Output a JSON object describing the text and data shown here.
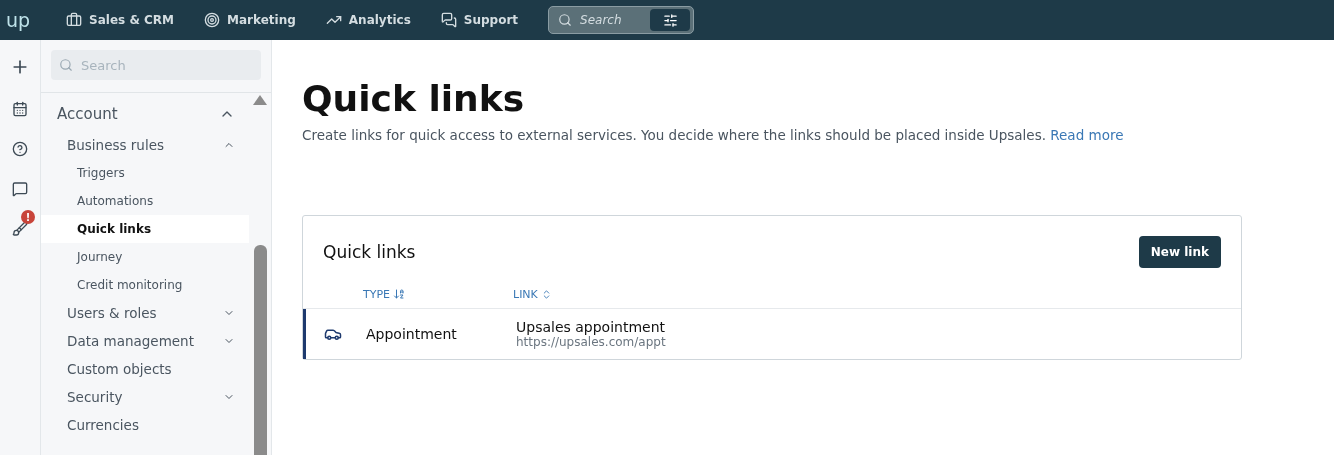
{
  "topbar": {
    "logo": "up",
    "nav": [
      {
        "label": "Sales & CRM"
      },
      {
        "label": "Marketing"
      },
      {
        "label": "Analytics"
      },
      {
        "label": "Support"
      }
    ],
    "search": {
      "placeholder": "Search"
    }
  },
  "rail": {
    "alert_badge": "!"
  },
  "sidebar": {
    "search": {
      "placeholder": "Search"
    },
    "items": [
      {
        "label": "Account",
        "kind": "group",
        "expanded": true,
        "selected": false,
        "children": [
          {
            "label": "Business rules",
            "kind": "group",
            "expanded": true,
            "selected": false,
            "children": [
              {
                "label": "Triggers",
                "kind": "page",
                "selected": false
              },
              {
                "label": "Automations",
                "kind": "page",
                "selected": false
              },
              {
                "label": "Quick links",
                "kind": "page",
                "selected": true
              },
              {
                "label": "Journey",
                "kind": "page",
                "selected": false
              },
              {
                "label": "Credit monitoring",
                "kind": "page",
                "selected": false
              }
            ]
          },
          {
            "label": "Users & roles",
            "kind": "group",
            "expanded": false,
            "selected": false
          },
          {
            "label": "Data management",
            "kind": "group",
            "expanded": false,
            "selected": false
          },
          {
            "label": "Custom objects",
            "kind": "page",
            "selected": false
          },
          {
            "label": "Security",
            "kind": "group",
            "expanded": false,
            "selected": false
          },
          {
            "label": "Currencies",
            "kind": "page",
            "selected": false
          }
        ]
      }
    ]
  },
  "page": {
    "title": "Quick links",
    "description": "Create links for quick access to external services. You decide where the links should be placed inside Upsales.",
    "read_more": "Read more"
  },
  "card": {
    "title": "Quick links",
    "button": "New link",
    "columns": [
      {
        "label": "TYPE"
      },
      {
        "label": "LINK"
      }
    ],
    "rows": [
      {
        "type": "Appointment",
        "name": "Upsales appointment",
        "url": "https://upsales.com/appt"
      }
    ]
  }
}
